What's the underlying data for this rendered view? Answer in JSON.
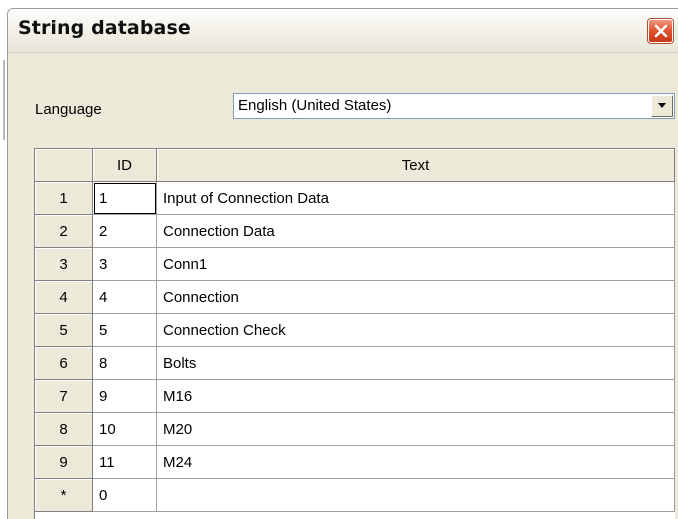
{
  "window": {
    "title": "String database"
  },
  "language": {
    "label": "Language",
    "value": "English (United States)"
  },
  "grid": {
    "columns": [
      "",
      "ID",
      "Text"
    ],
    "rows": [
      {
        "num": "1",
        "id": "1",
        "text": "Input of Connection Data"
      },
      {
        "num": "2",
        "id": "2",
        "text": "Connection Data"
      },
      {
        "num": "3",
        "id": "3",
        "text": "Conn1"
      },
      {
        "num": "4",
        "id": "4",
        "text": "Connection"
      },
      {
        "num": "5",
        "id": "5",
        "text": "Connection Check"
      },
      {
        "num": "6",
        "id": "8",
        "text": "Bolts"
      },
      {
        "num": "7",
        "id": "9",
        "text": "M16"
      },
      {
        "num": "8",
        "id": "10",
        "text": "M20"
      },
      {
        "num": "9",
        "id": "11",
        "text": "M24"
      },
      {
        "num": "*",
        "id": "0",
        "text": ""
      }
    ]
  },
  "icons": {
    "close": "close-icon",
    "dropdown": "chevron-down-icon"
  },
  "colors": {
    "dialog_background": "#ece9d8",
    "close_button": "#e0512e",
    "grid_lines": "#a0a0a0"
  }
}
